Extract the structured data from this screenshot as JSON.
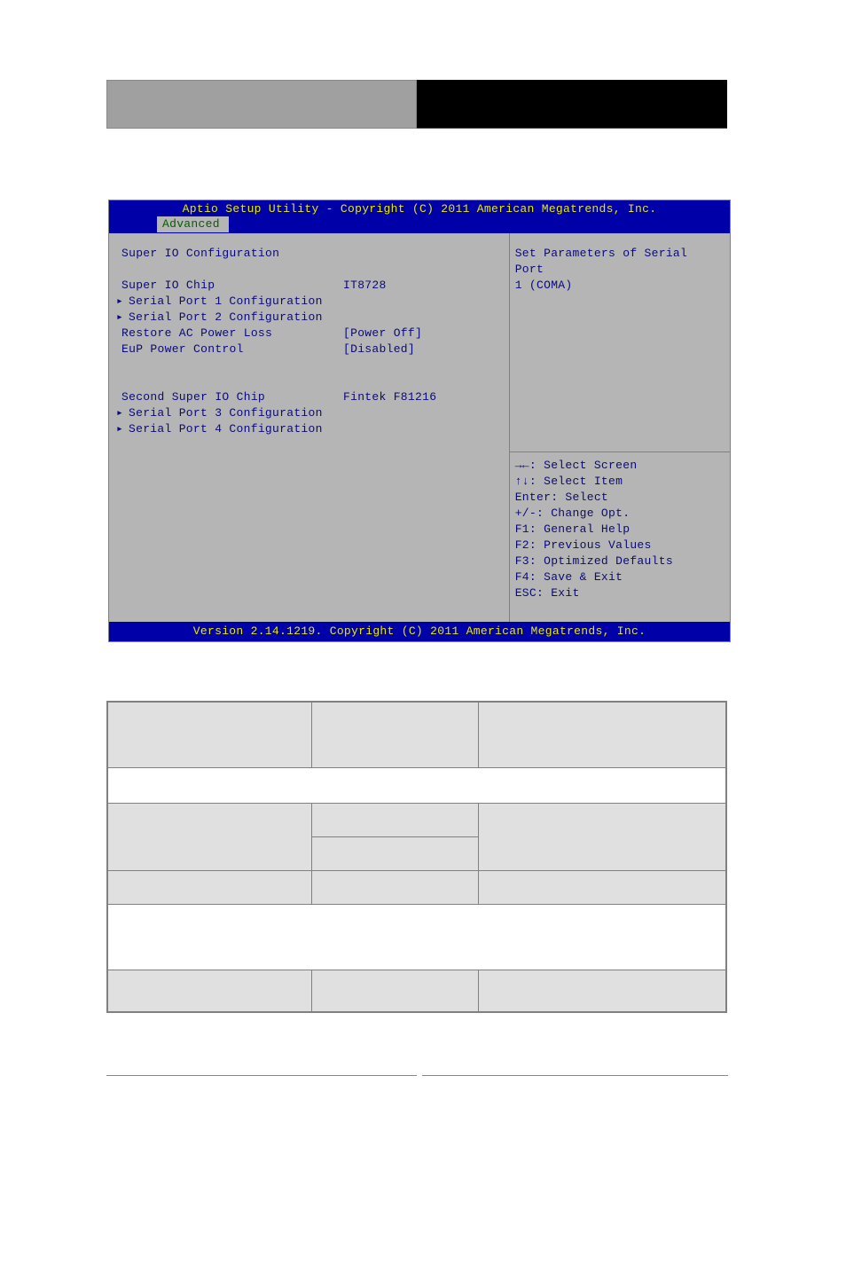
{
  "bios": {
    "title": "Aptio Setup Utility - Copyright (C) 2011 American Megatrends, Inc.",
    "footer": "Version 2.14.1219. Copyright (C) 2011 American Megatrends, Inc.",
    "tab_active": "Advanced",
    "section_title": "Super IO Configuration",
    "rows": [
      {
        "label": "Super IO Chip",
        "value": "IT8728"
      }
    ],
    "submenus1": [
      "Serial Port 1 Configuration",
      "Serial Port 2 Configuration"
    ],
    "opts": [
      {
        "label": "Restore AC Power Loss",
        "value": "[Power Off]"
      },
      {
        "label": "EuP Power Control",
        "value": "[Disabled]"
      }
    ],
    "second_chip_label": "Second Super IO Chip",
    "second_chip_value": "Fintek F81216",
    "submenus2": [
      "Serial Port 3 Configuration",
      "Serial Port 4 Configuration"
    ],
    "help_text_line1": "Set Parameters of Serial Port",
    "help_text_line2": "1 (COMA)",
    "keyhelp": [
      "→←: Select Screen",
      "↑↓: Select Item",
      "Enter: Select",
      "+/-: Change Opt.",
      "F1: General Help",
      "F2: Previous Values",
      "F3: Optimized Defaults",
      "F4: Save & Exit",
      "ESC: Exit"
    ]
  }
}
